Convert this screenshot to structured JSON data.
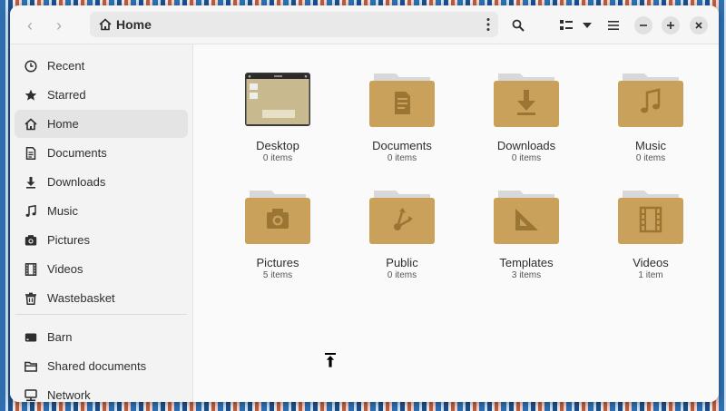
{
  "path": {
    "location": "Home"
  },
  "sidebar": {
    "items": [
      {
        "label": "Recent",
        "icon": "clock-icon"
      },
      {
        "label": "Starred",
        "icon": "star-icon"
      },
      {
        "label": "Home",
        "icon": "home-icon",
        "active": true
      },
      {
        "label": "Documents",
        "icon": "document-icon"
      },
      {
        "label": "Downloads",
        "icon": "download-icon"
      },
      {
        "label": "Music",
        "icon": "music-icon"
      },
      {
        "label": "Pictures",
        "icon": "camera-icon"
      },
      {
        "label": "Videos",
        "icon": "film-icon"
      },
      {
        "label": "Wastebasket",
        "icon": "trash-icon"
      },
      {
        "label": "Barn",
        "icon": "drive-icon"
      },
      {
        "label": "Shared documents",
        "icon": "folder-icon"
      },
      {
        "label": "Network",
        "icon": "network-icon"
      }
    ]
  },
  "files": [
    {
      "name": "Desktop",
      "count": "0 items",
      "icon": "desktop-folder-icon"
    },
    {
      "name": "Documents",
      "count": "0 items",
      "icon": "documents-folder-icon"
    },
    {
      "name": "Downloads",
      "count": "0 items",
      "icon": "downloads-folder-icon"
    },
    {
      "name": "Music",
      "count": "0 items",
      "icon": "music-folder-icon"
    },
    {
      "name": "Pictures",
      "count": "5 items",
      "icon": "pictures-folder-icon"
    },
    {
      "name": "Public",
      "count": "0 items",
      "icon": "public-folder-icon"
    },
    {
      "name": "Templates",
      "count": "3 items",
      "icon": "templates-folder-icon"
    },
    {
      "name": "Videos",
      "count": "1 item",
      "icon": "videos-folder-icon"
    }
  ],
  "colors": {
    "folder": "#c9a15b",
    "folder_dark": "#9b7533",
    "folder_tab": "#d8d8d8",
    "accent": "#2e2e2e"
  }
}
